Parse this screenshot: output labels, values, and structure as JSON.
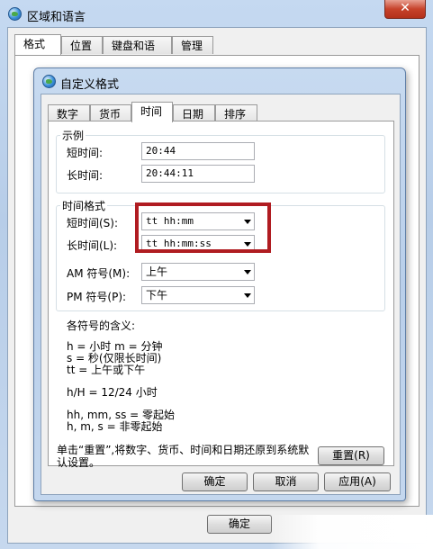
{
  "outer_window": {
    "title": "区域和语言",
    "close_label": "✕",
    "tabs": [
      "格式",
      "位置",
      "键盘和语言",
      "管理"
    ],
    "ok_label": "确定"
  },
  "dialog": {
    "title": "自定义格式",
    "tabs": [
      "数字",
      "货币",
      "时间",
      "日期",
      "排序"
    ],
    "active_tab": "时间",
    "example": {
      "legend": "示例",
      "short_time_label": "短时间:",
      "short_time_value": "20:44",
      "long_time_label": "长时间:",
      "long_time_value": "20:44:11"
    },
    "time_formats": {
      "legend": "时间格式",
      "short_time_label": "短时间(S):",
      "short_time_value": "tt hh:mm",
      "long_time_label": "长时间(L):",
      "long_time_value": "tt hh:mm:ss",
      "am_label": "AM 符号(M):",
      "am_value": "上午",
      "pm_label": "PM 符号(P):",
      "pm_value": "下午"
    },
    "notation": {
      "heading": "各符号的含义:",
      "line1": "h = 小时   m = 分钟",
      "line2": "s = 秒(仅限长时间)",
      "line3": "tt = 上午或下午",
      "line4": "h/H = 12/24 小时",
      "line5": "hh, mm, ss = 零起始",
      "line6": "h, m, s = 非零起始"
    },
    "reset_note": "单击“重置”,将数字、货币、时间和日期还原到系统默认设置。",
    "reset_label": "重置(R)",
    "ok_label": "确定",
    "cancel_label": "取消",
    "apply_label": "应用(A)"
  },
  "colors": {
    "highlight": "#b01c21",
    "title_bar": "#b9cfea",
    "close_button": "#c7432b"
  }
}
